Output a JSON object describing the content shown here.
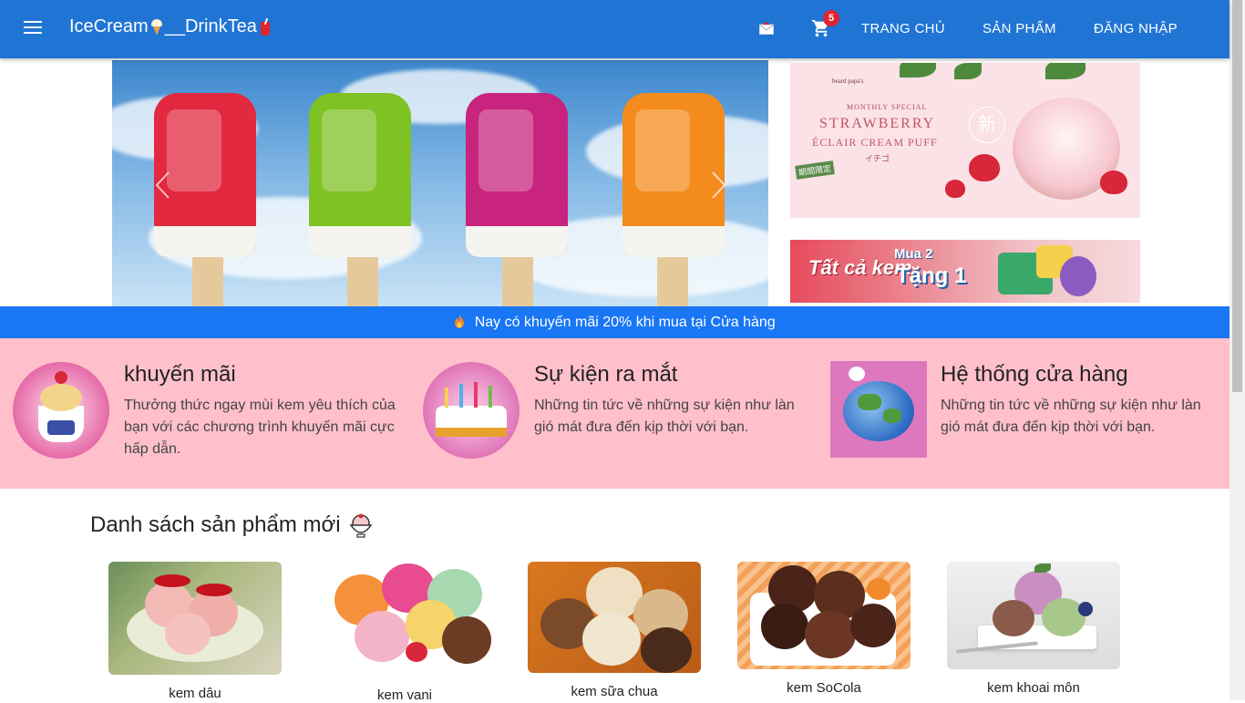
{
  "navbar": {
    "brand_part1": "IceCream",
    "brand_part2": "__DrinkTea",
    "cart_count": "5",
    "links": [
      "TRANG CHỦ",
      "SẢN PHẨM",
      "ĐĂNG NHẬP"
    ]
  },
  "ads": {
    "ad1": {
      "brand": "beard papa's",
      "line1": "MONTHLY SPECIAL",
      "line2": "STRAWBERRY",
      "line3": "ÉCLAIR CREAM PUFF",
      "line4": "イチゴ",
      "tag": "期間限定",
      "kanji": "新"
    },
    "ad2": {
      "text1": "Tất cả kem",
      "text2": "Mua 2",
      "text3": "Tặng 1"
    }
  },
  "promo": {
    "text": "Nay có khuyến mãi 20% khi mua tại Cửa hàng"
  },
  "features": [
    {
      "title": "khuyến mãi",
      "desc": "Thưởng thức ngay mùi kem yêu thích của bạn với các chương trình khuyến mãi cực hấp dẫn."
    },
    {
      "title": "Sự kiện ra mắt",
      "desc": "Những tin tức về những sự kiện như làn gió mát đưa đến kịp thời với bạn."
    },
    {
      "title": "Hệ thống cửa hàng",
      "desc": "Những tin tức về những sự kiện như làn gió mát đưa đến kịp thời với bạn."
    }
  ],
  "products_section": {
    "title": "Danh sách sản phẩm mới",
    "items": [
      {
        "name": "kem dâu"
      },
      {
        "name": "kem vani"
      },
      {
        "name": "kem sữa chua"
      },
      {
        "name": "kem SoCola"
      },
      {
        "name": "kem khoai môn"
      }
    ]
  },
  "icons": {
    "menu": "hamburger-menu-icon",
    "mail": "mail-icon",
    "cart": "shopping-cart-icon",
    "flame": "fire-icon",
    "bowl": "ice-cream-bowl-icon",
    "arrow_left": "chevron-left-icon",
    "arrow_right": "chevron-right-icon"
  },
  "colors": {
    "navbar": "#1f74d4",
    "promo": "#1976f5",
    "features_bg": "#ffc0cb",
    "badge": "#e0242f"
  }
}
